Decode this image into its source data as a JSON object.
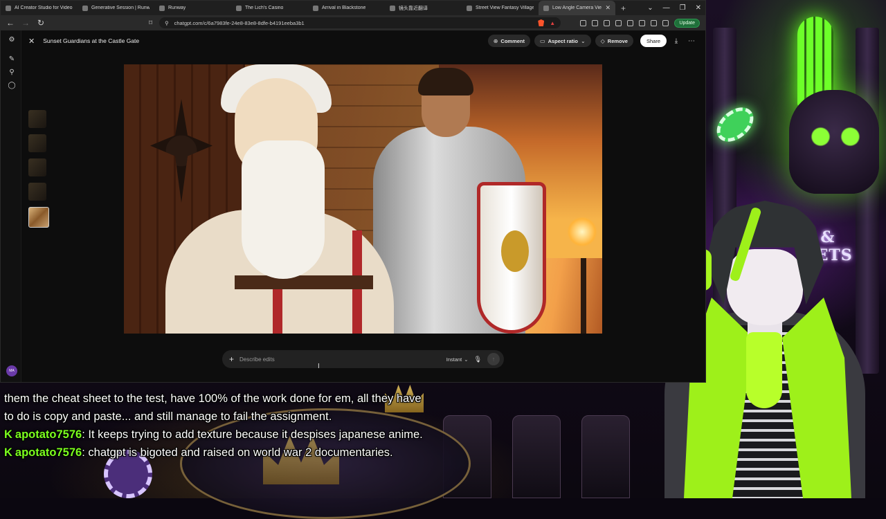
{
  "browser": {
    "tabs": [
      {
        "label": "AI Creator Studio for Video &",
        "active": false
      },
      {
        "label": "Generative Session | Runway",
        "active": false
      },
      {
        "label": "Runway",
        "active": false
      },
      {
        "label": "The Lich's Casino",
        "active": false
      },
      {
        "label": "Arrival in Blackstone",
        "active": false
      },
      {
        "label": "镜头靠近翻译",
        "active": false
      },
      {
        "label": "Street View Fantasy Village",
        "active": false
      },
      {
        "label": "Low Angle Camera View",
        "active": true
      }
    ],
    "new_tab_icon": "plus-icon",
    "url": "chatgpt.com/c/6a7983fe-24e8-83e8-8dfe-b4191eeba3b1",
    "update_label": "Update"
  },
  "editor": {
    "title": "Sunset Guardians at the Castle Gate",
    "comment_label": "Comment",
    "aspect_label": "Aspect ratio",
    "remove_label": "Remove",
    "share_label": "Share",
    "user_initials": "MA",
    "composer": {
      "placeholder": "Describe edits",
      "mode_label": "Instant"
    }
  },
  "stream": {
    "sign_text": "S & BETS",
    "chat": [
      {
        "user": "",
        "text": "them the cheat sheet to the test, have 100% of the work done for em, all they have to do is copy and paste... and still manage to fail the assignment."
      },
      {
        "user": "apotato7576",
        "text": ": It keeps trying to add texture because it despises japanese anime."
      },
      {
        "user": "apotato7576",
        "text": ": chatgpt is bigoted and raised on world war 2 documentaries."
      }
    ]
  },
  "colors": {
    "accent_green": "#7cff1e",
    "page_bg": "#0d0d0d",
    "share_bg": "#ffffff"
  }
}
